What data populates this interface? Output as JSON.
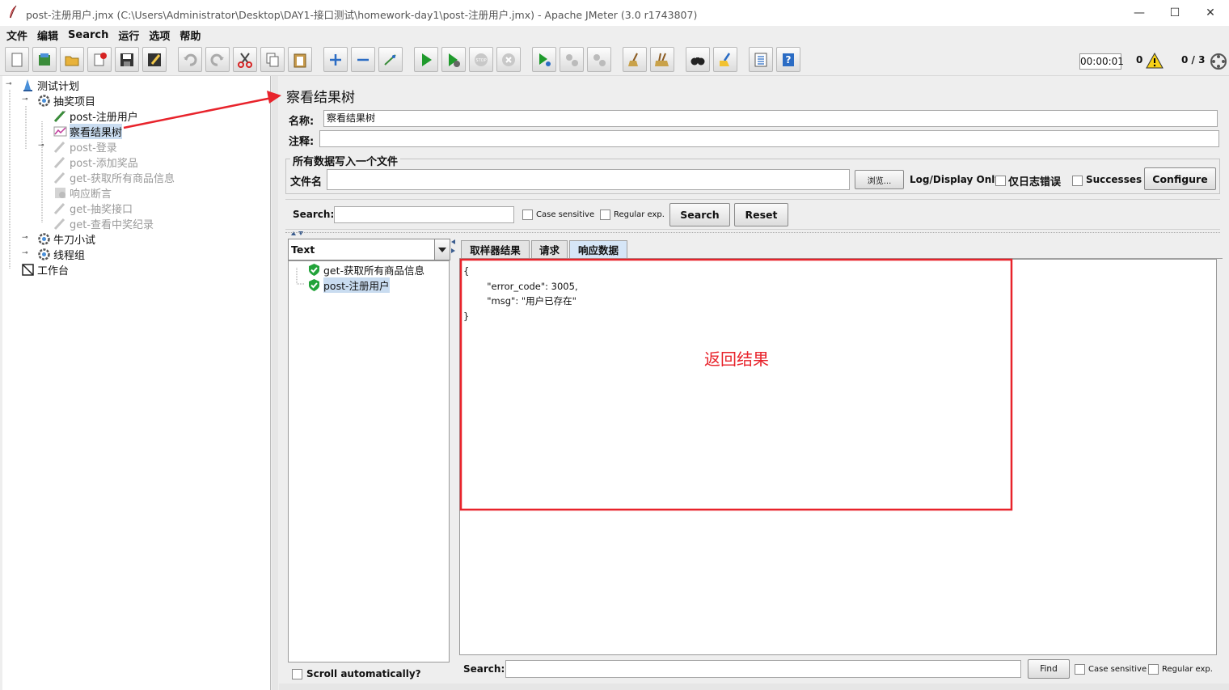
{
  "window": {
    "title": "post-注册用户.jmx (C:\\Users\\Administrator\\Desktop\\DAY1-接口测试\\homework-day1\\post-注册用户.jmx) - Apache JMeter (3.0 r1743807)",
    "minimize": "—",
    "maximize": "☐",
    "close": "✕"
  },
  "menu": [
    "文件",
    "编辑",
    "Search",
    "运行",
    "选项",
    "帮助"
  ],
  "status": {
    "elapsed": "00:00:01",
    "warnings": "0",
    "threads": "0 / 3"
  },
  "tree": {
    "nodes": [
      {
        "label": "测试计划",
        "icon": "test-plan-icon",
        "disabled": false,
        "selected": false
      },
      {
        "label": "抽奖项目",
        "icon": "thread-group-gear-icon",
        "disabled": false,
        "selected": false
      },
      {
        "label": "post-注册用户",
        "icon": "sampler-pen-icon",
        "disabled": false,
        "selected": false
      },
      {
        "label": "察看结果树",
        "icon": "listener-graph-icon",
        "disabled": false,
        "selected": true
      },
      {
        "label": "post-登录",
        "icon": "sampler-pen-icon",
        "disabled": true,
        "selected": false
      },
      {
        "label": "post-添加奖品",
        "icon": "sampler-pen-icon",
        "disabled": true,
        "selected": false
      },
      {
        "label": "get-获取所有商品信息",
        "icon": "sampler-pen-icon",
        "disabled": true,
        "selected": false
      },
      {
        "label": "响应断言",
        "icon": "assertion-icon",
        "disabled": true,
        "selected": false
      },
      {
        "label": "get-抽奖接口",
        "icon": "sampler-pen-icon",
        "disabled": true,
        "selected": false
      },
      {
        "label": "get-查看中奖纪录",
        "icon": "sampler-pen-icon",
        "disabled": true,
        "selected": false
      },
      {
        "label": "牛刀小试",
        "icon": "thread-group-gear-icon",
        "disabled": false,
        "selected": false
      },
      {
        "label": "线程组",
        "icon": "thread-group-gear-icon",
        "disabled": false,
        "selected": false
      },
      {
        "label": "工作台",
        "icon": "workbench-icon",
        "disabled": false,
        "selected": false
      }
    ]
  },
  "panel": {
    "title": "察看结果树",
    "name_label": "名称:",
    "name_value": "察看结果树",
    "comment_label": "注释:",
    "comment_value": "",
    "file_group_title": "所有数据写入一个文件",
    "filename_label": "文件名",
    "filename_value": "",
    "browse_label": "浏览...",
    "log_display_label": "Log/Display Only:",
    "errors_only_label": "仅日志错误",
    "successes_label": "Successes",
    "configure_label": "Configure",
    "search_label": "Search:",
    "search_value": "",
    "case_sensitive_label": "Case sensitive",
    "regular_exp_label": "Regular exp.",
    "search_button": "Search",
    "reset_button": "Reset"
  },
  "results": {
    "renderer": "Text",
    "samples": [
      {
        "label": "get-获取所有商品信息",
        "status": "success",
        "selected": false
      },
      {
        "label": "post-注册用户",
        "status": "success",
        "selected": true
      }
    ],
    "scroll_label": "Scroll automatically?",
    "tabs": [
      {
        "label": "取样器结果",
        "active": false
      },
      {
        "label": "请求",
        "active": false
      },
      {
        "label": "响应数据",
        "active": true
      }
    ],
    "response_body": "{\n        \"error_code\": 3005,\n        \"msg\": \"用户已存在\"\n}",
    "find_label": "Search:",
    "find_value": "",
    "find_button": "Find",
    "find_case_label": "Case sensitive",
    "find_regex_label": "Regular exp."
  },
  "annotation": {
    "text": "返回结果",
    "color": "#e8232b"
  }
}
